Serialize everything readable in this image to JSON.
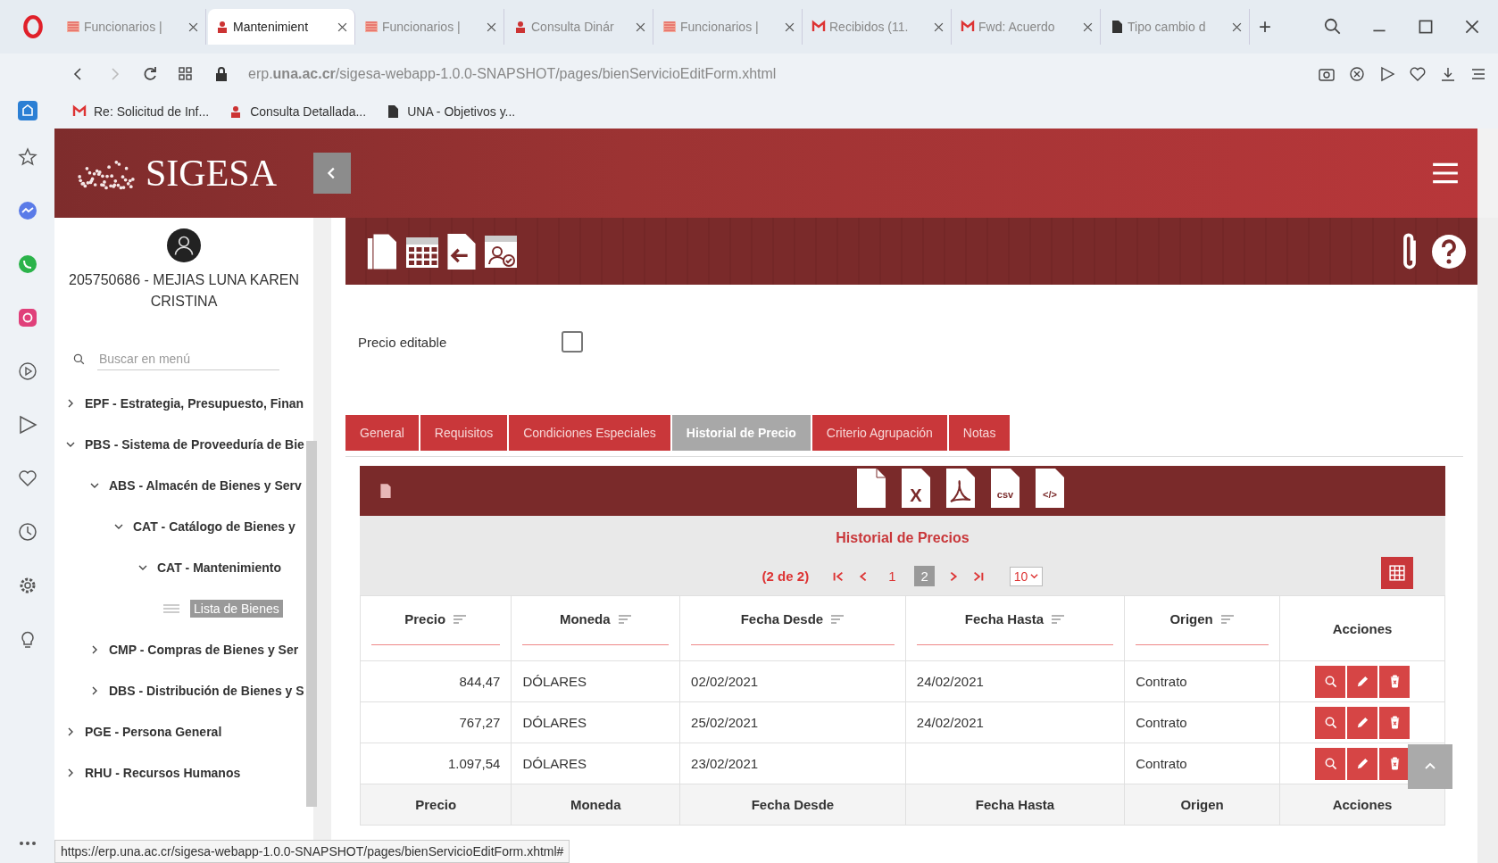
{
  "browser": {
    "tabs": [
      {
        "kind": "una",
        "title": "Funcionarios |",
        "selected": false
      },
      {
        "kind": "sigesa",
        "title": "Mantenimient",
        "selected": true
      },
      {
        "kind": "una",
        "title": "Funcionarios |",
        "selected": false
      },
      {
        "kind": "sigesa",
        "title": "Consulta Dinár",
        "selected": false
      },
      {
        "kind": "una",
        "title": "Funcionarios |",
        "selected": false
      },
      {
        "kind": "gmail",
        "title": "Recibidos (11.",
        "selected": false
      },
      {
        "kind": "gmail",
        "title": "Fwd: Acuerdo",
        "selected": false
      },
      {
        "kind": "doc",
        "title": "Tipo cambio d",
        "selected": false
      }
    ],
    "new_tab": "+",
    "url": "erp.**una.ac.cr**/sigesa-webapp-1.0.0-SNAPSHOT/pages/bienServicioEditForm.xhtml",
    "bookmarks": [
      {
        "kind": "gmail",
        "title": "Re: Solicitud de Inf..."
      },
      {
        "kind": "sigesa",
        "title": "Consulta Detallada..."
      },
      {
        "kind": "doc",
        "title": "UNA - Objetivos y..."
      }
    ],
    "status_url": "https://erp.una.ac.cr/sigesa-webapp-1.0.0-SNAPSHOT/pages/bienServicioEditForm.xhtml#"
  },
  "app": {
    "logo": "SIGESA"
  },
  "sidebar": {
    "user": "205750686 - MEJIAS LUNA KAREN CRISTINA",
    "search": {
      "placeholder": "Buscar en menú"
    },
    "items": [
      {
        "kind": "branch",
        "label": "EPF - Estrategia, Presupuesto, Finan",
        "expanded": false,
        "selected": false
      },
      {
        "kind": "branch",
        "label": "PBS - Sistema de Proveeduría de Bie",
        "expanded": true,
        "selected": false,
        "children": [
          {
            "kind": "branch",
            "label": "ABS - Almacén de Bienes y Serv",
            "expanded": true,
            "selected": false,
            "children": [
              {
                "kind": "branch",
                "label": "CAT - Catálogo de Bienes y",
                "expanded": true,
                "selected": false,
                "children": [
                  {
                    "kind": "branch",
                    "label": "CAT - Mantenimiento",
                    "expanded": true,
                    "selected": false,
                    "children": [
                      {
                        "kind": "leaf",
                        "label": "Lista de Bienes",
                        "selected": true
                      }
                    ]
                  }
                ]
              }
            ]
          },
          {
            "kind": "branch",
            "label": "CMP - Compras de Bienes y Ser",
            "expanded": false,
            "selected": false
          },
          {
            "kind": "branch",
            "label": "DBS - Distribución de Bienes y S",
            "expanded": false,
            "selected": false
          }
        ]
      },
      {
        "kind": "branch",
        "label": "PGE - Persona General",
        "expanded": false,
        "selected": false
      },
      {
        "kind": "branch",
        "label": "RHU - Recursos Humanos",
        "expanded": false,
        "selected": false
      }
    ]
  },
  "form": {
    "price_editable": {
      "label": "Precio editable",
      "checked": false
    }
  },
  "tabs": [
    {
      "label": "General",
      "selected": false
    },
    {
      "label": "Requisitos",
      "selected": false
    },
    {
      "label": "Condiciones Especiales",
      "selected": false
    },
    {
      "label": "Historial de Precio",
      "selected": true
    },
    {
      "label": "Criterio Agrupación",
      "selected": false
    },
    {
      "label": "Notas",
      "selected": false
    }
  ],
  "table": {
    "exports": [
      {
        "kind": "doc"
      },
      {
        "kind": "excel",
        "label": "X"
      },
      {
        "kind": "pdf"
      },
      {
        "kind": "csv",
        "label": "csv"
      },
      {
        "kind": "xml",
        "label": "</>"
      }
    ],
    "title": "Historial de Precios",
    "paginator": {
      "summary": "(2 de 2)",
      "pages": [
        {
          "label": "1",
          "selected": false
        },
        {
          "label": "2",
          "selected": true
        }
      ],
      "rows_per_page": "10"
    },
    "columns": [
      {
        "label": "Precio",
        "sortable": true
      },
      {
        "label": "Moneda",
        "sortable": true
      },
      {
        "label": "Fecha Desde",
        "sortable": true
      },
      {
        "label": "Fecha Hasta",
        "sortable": true
      },
      {
        "label": "Origen",
        "sortable": true
      },
      {
        "label": "Acciones",
        "sortable": false
      }
    ],
    "rows": [
      [
        "844,47",
        "DÓLARES",
        "02/02/2021",
        "24/02/2021",
        "Contrato"
      ],
      [
        "767,27",
        "DÓLARES",
        "25/02/2021",
        "24/02/2021",
        "Contrato"
      ],
      [
        "1.097,54",
        "DÓLARES",
        "23/02/2021",
        "",
        "Contrato"
      ]
    ],
    "footer": [
      "Precio",
      "Moneda",
      "Fecha Desde",
      "Fecha Hasta",
      "Origen",
      "Acciones"
    ]
  }
}
